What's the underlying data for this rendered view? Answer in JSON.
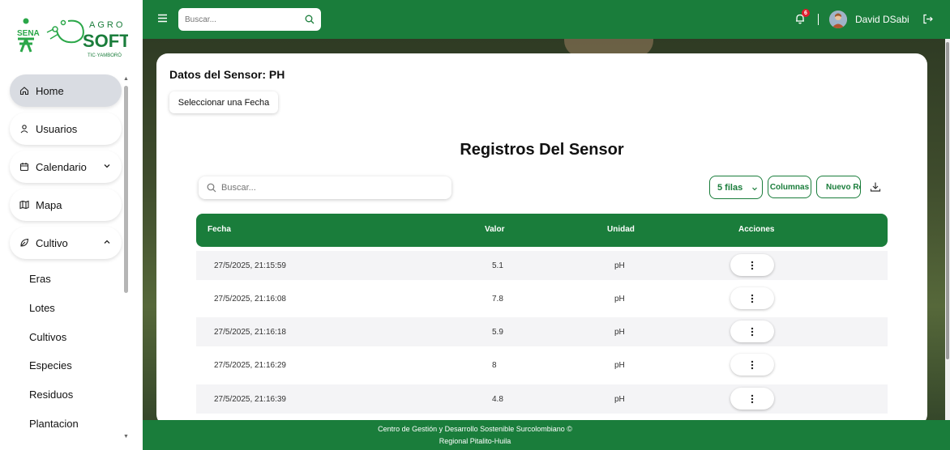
{
  "sidebar": {
    "logo": {
      "primary": "SENA",
      "brand_top": "AGRO",
      "brand_main": "SOFT",
      "brand_sub": "TIC·YAMBORÓ"
    },
    "items": [
      {
        "label": "Home",
        "icon": "home-icon",
        "active": true
      },
      {
        "label": "Usuarios",
        "icon": "user-icon"
      },
      {
        "label": "Calendario",
        "icon": "calendar-icon",
        "chevron": "chevron-down-icon"
      },
      {
        "label": "Mapa",
        "icon": "map-icon"
      },
      {
        "label": "Cultivo",
        "icon": "leaf-icon",
        "chevron": "chevron-up-icon",
        "expanded": true
      }
    ],
    "sub_items": [
      "Eras",
      "Lotes",
      "Cultivos",
      "Especies",
      "Residuos",
      "Plantacion"
    ]
  },
  "topbar": {
    "search_placeholder": "Buscar...",
    "notification_count": "6",
    "separator": "|",
    "user_name": "David DSabi"
  },
  "card": {
    "sensor_title": "Datos del Sensor: PH",
    "date_button": "Seleccionar una Fecha",
    "records_title": "Registros Del Sensor",
    "table_search_placeholder": "Buscar...",
    "rows_select": "5 filas",
    "columns_button": "Columnas",
    "new_button": "Nuevo Re",
    "columns": [
      "Fecha",
      "Valor",
      "Unidad",
      "Acciones"
    ],
    "rows": [
      {
        "fecha": "27/5/2025, 21:15:59",
        "valor": "5.1",
        "unidad": "pH"
      },
      {
        "fecha": "27/5/2025, 21:16:08",
        "valor": "7.8",
        "unidad": "pH"
      },
      {
        "fecha": "27/5/2025, 21:16:18",
        "valor": "5.9",
        "unidad": "pH"
      },
      {
        "fecha": "27/5/2025, 21:16:29",
        "valor": "8",
        "unidad": "pH"
      },
      {
        "fecha": "27/5/2025, 21:16:39",
        "valor": "4.8",
        "unidad": "pH"
      }
    ]
  },
  "footer": {
    "line1": "Centro de Gestión y Desarrollo Sostenible Surcolombiano ©",
    "line2": "Regional Pitalito-Huila"
  },
  "colors": {
    "brand_green": "#1a7d3b",
    "badge_red": "#e11d2e",
    "active_item": "#d9dce2"
  }
}
